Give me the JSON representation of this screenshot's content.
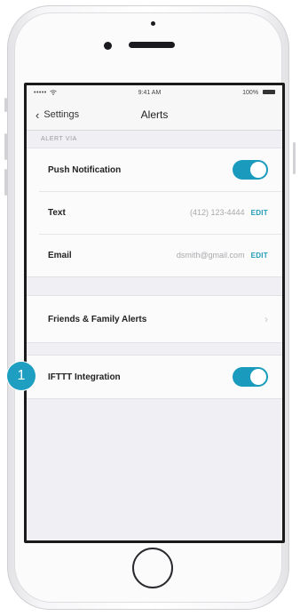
{
  "status_bar": {
    "carrier": "•••••",
    "time": "9:41 AM",
    "battery": "100%"
  },
  "nav": {
    "back_label": "Settings",
    "title": "Alerts"
  },
  "section_header": "ALERT VIA",
  "alert_via": {
    "push": {
      "label": "Push Notification",
      "enabled": true
    },
    "text": {
      "label": "Text",
      "value": "(412) 123-4444",
      "action": "EDIT"
    },
    "email": {
      "label": "Email",
      "value": "dsmith@gmail.com",
      "action": "EDIT"
    }
  },
  "friends": {
    "label": "Friends & Family Alerts"
  },
  "ifttt": {
    "label": "IFTTT Integration",
    "enabled": true
  },
  "callout": {
    "number": "1"
  },
  "colors": {
    "accent": "#1a9bbd",
    "callout": "#1e9fc1"
  }
}
